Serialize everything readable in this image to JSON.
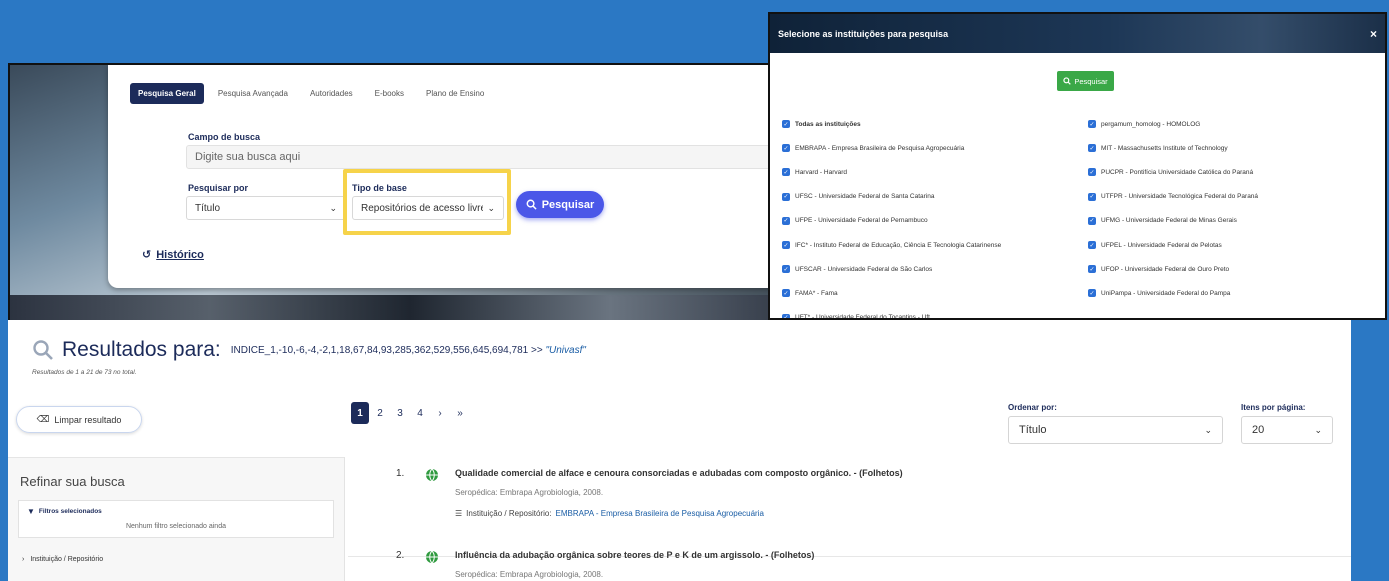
{
  "search": {
    "tabs": [
      {
        "label": "Pesquisa Geral",
        "active": true
      },
      {
        "label": "Pesquisa Avançada",
        "active": false
      },
      {
        "label": "Autoridades",
        "active": false
      },
      {
        "label": "E-books",
        "active": false
      },
      {
        "label": "Plano de Ensino",
        "active": false
      }
    ],
    "campo_label": "Campo de busca",
    "campo_placeholder": "Digite sua busca aqui",
    "pesquisar_por_label": "Pesquisar por",
    "pesquisar_por_value": "Título",
    "tipo_base_label": "Tipo de base",
    "tipo_base_value": "Repositórios de acesso livre",
    "search_button": "Pesquisar",
    "historico": "Histórico",
    "highlight_color": "#f6d34a",
    "button_color": "#4b57e8"
  },
  "modal": {
    "title": "Selecione as instituições para pesquisa",
    "close": "×",
    "search_button": "Pesquisar",
    "left": [
      "Todas as instituições",
      "EMBRAPA - Empresa Brasileira de Pesquisa Agropecuária",
      "Harvard - Harvard",
      "UFSC - Universidade Federal de Santa Catarina",
      "UFPE - Universidade Federal de Pernambuco",
      "IFC* - Instituto Federal de Educação, Ciência E Tecnologia Catarinense",
      "UFSCAR - Universidade Federal de São Carlos",
      "FAMA* - Fama",
      "UFT* - Universidade Federal do Tocantins - Uft"
    ],
    "right": [
      "pergamum_homolog - HOMOLOG",
      "MIT - Massachusetts Institute of Technology",
      "PUCPR - Pontifícia Universidade Católica do Paraná",
      "UTFPR - Universidade Tecnológica Federal do Paraná",
      "UFMG - Universidade Federal de Minas Gerais",
      "UFPEL - Universidade Federal de Pelotas",
      "UFOP - Universidade Federal de Ouro Preto",
      "UniPampa - Universidade Federal do Pampa"
    ]
  },
  "results": {
    "title": "Resultados para:",
    "query": "INDICE_1,-10,-6,-4,-2,1,18,67,84,93,285,362,529,556,645,694,781 >>",
    "query_base": "\"Univasf\"",
    "count": "Resultados de 1 a 21 de 73 no total.",
    "clear_button": "Limpar resultado",
    "pages": [
      "1",
      "2",
      "3",
      "4",
      "›",
      "»"
    ],
    "ordenar_label": "Ordenar por:",
    "ordenar_value": "Título",
    "itens_label": "Itens por página:",
    "itens_value": "20",
    "refine_title": "Refinar sua busca",
    "filtros_title": "Filtros selecionados",
    "filtros_empty": "Nenhum filtro selecionado ainda",
    "facet": "Instituição / Repositório",
    "records": [
      {
        "num": "1.",
        "title": "Qualidade comercial de alface e cenoura consorciadas e adubadas com composto orgânico. - (Folhetos)",
        "pub": "Seropédica: Embrapa Agrobiologia, 2008.",
        "inst_label": "Instituição / Repositório:",
        "inst_value": "EMBRAPA - Empresa Brasileira de Pesquisa Agropecuária"
      },
      {
        "num": "2.",
        "title": "Influência da adubação orgânica sobre teores de P e K de um argissolo. - (Folhetos)",
        "pub": "Seropédica: Embrapa Agrobiologia, 2008."
      }
    ]
  }
}
